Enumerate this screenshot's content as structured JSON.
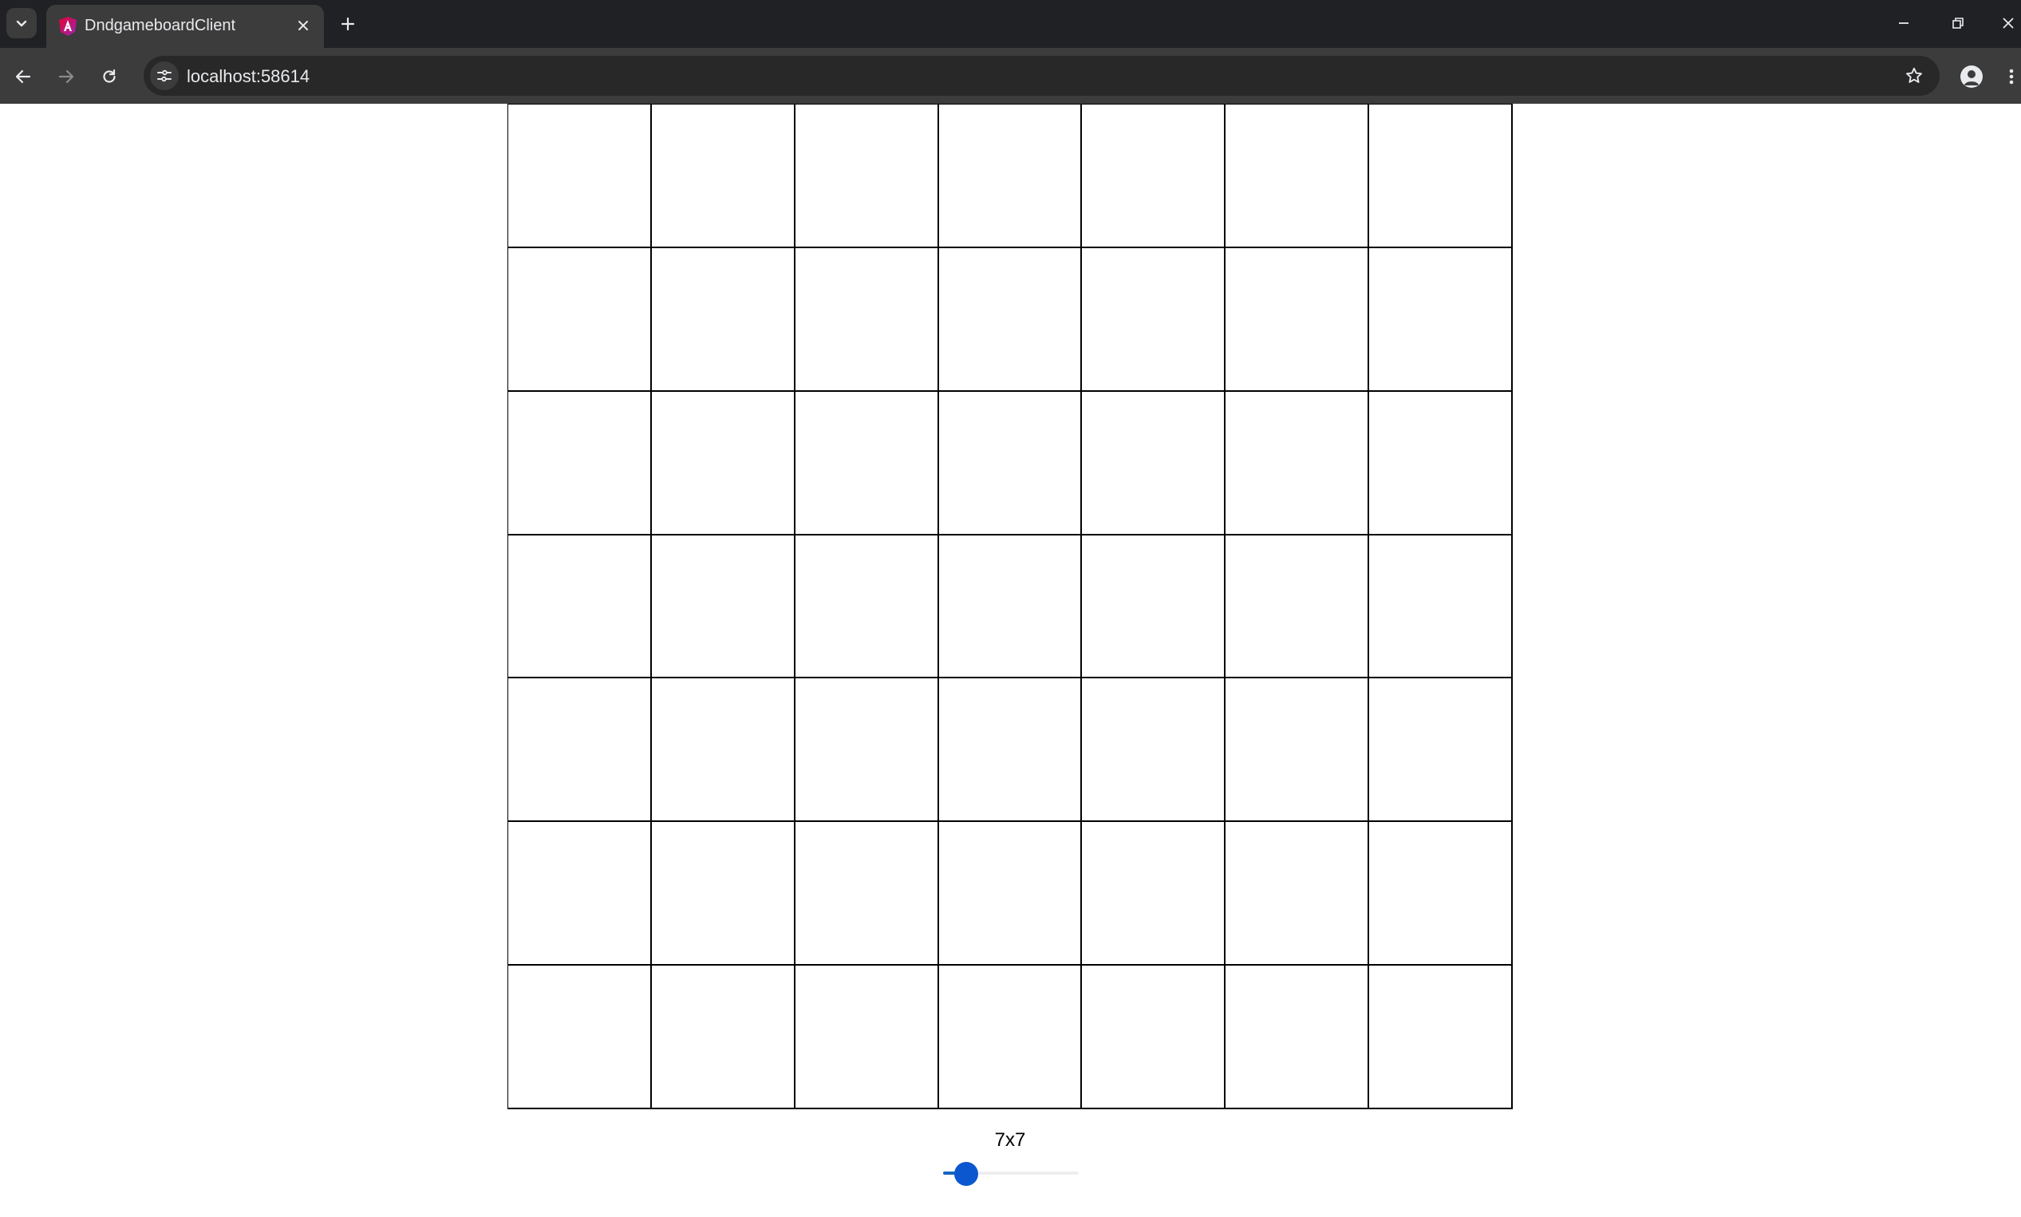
{
  "browser": {
    "tab_title": "DndgameboardClient",
    "url": "localhost:58614",
    "colors": {
      "tabstrip": "#202124",
      "toolbar": "#3c3c3c",
      "text": "#e8eaed"
    }
  },
  "board": {
    "rows": 7,
    "columns": 7,
    "size_label": "7x7"
  },
  "size_slider": {
    "value_fraction": 0.1,
    "accent": "#0b57d0"
  }
}
